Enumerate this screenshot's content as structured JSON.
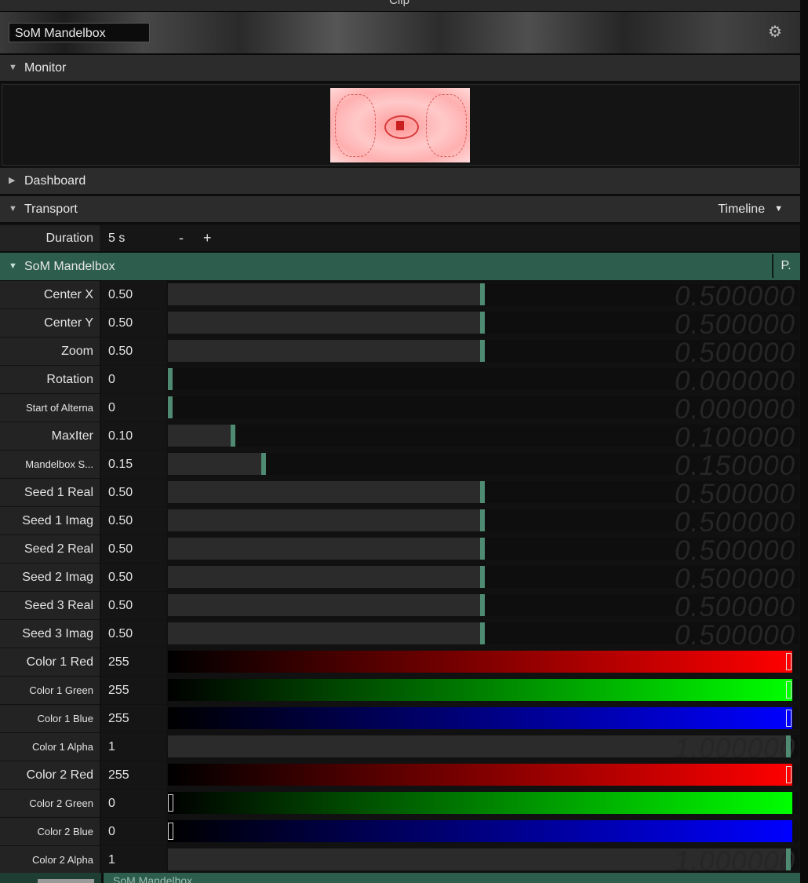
{
  "window": {
    "title": "Clip"
  },
  "clip": {
    "name": "SoM Mandelbox",
    "settings_icon": "gear-icon"
  },
  "sections": {
    "monitor": "Monitor",
    "dashboard": "Dashboard",
    "transport": "Transport",
    "transport_mode": "Timeline"
  },
  "duration": {
    "label": "Duration",
    "value": "5 s",
    "minus": "-",
    "plus": "+"
  },
  "effect": {
    "name": "SoM Mandelbox",
    "p_button": "P."
  },
  "params": [
    {
      "label": "Center X",
      "value": "0.50",
      "level": 0.5,
      "ghost": "0.500000"
    },
    {
      "label": "Center Y",
      "value": "0.50",
      "level": 0.5,
      "ghost": "0.500000"
    },
    {
      "label": "Zoom",
      "value": "0.50",
      "level": 0.5,
      "ghost": "0.500000"
    },
    {
      "label": "Rotation",
      "value": "0",
      "level": 0.0,
      "ghost": "0.000000"
    },
    {
      "label": "Start of Alterna",
      "value": "0",
      "level": 0.0,
      "ghost": "0.000000"
    },
    {
      "label": "MaxIter",
      "value": "0.10",
      "level": 0.1,
      "ghost": "0.100000"
    },
    {
      "label": "Mandelbox S...",
      "value": "0.15",
      "level": 0.15,
      "ghost": "0.150000"
    },
    {
      "label": "Seed 1 Real",
      "value": "0.50",
      "level": 0.5,
      "ghost": "0.500000"
    },
    {
      "label": "Seed 1 Imag",
      "value": "0.50",
      "level": 0.5,
      "ghost": "0.500000"
    },
    {
      "label": "Seed 2 Real",
      "value": "0.50",
      "level": 0.5,
      "ghost": "0.500000"
    },
    {
      "label": "Seed 2 Imag",
      "value": "0.50",
      "level": 0.5,
      "ghost": "0.500000"
    },
    {
      "label": "Seed 3 Real",
      "value": "0.50",
      "level": 0.5,
      "ghost": "0.500000"
    },
    {
      "label": "Seed 3 Imag",
      "value": "0.50",
      "level": 0.5,
      "ghost": "0.500000"
    },
    {
      "label": "Color 1 Red",
      "value": "255",
      "level": 1.0,
      "color": "#ff0000"
    },
    {
      "label": "Color 1 Green",
      "value": "255",
      "level": 1.0,
      "color": "#00ff00"
    },
    {
      "label": "Color 1 Blue",
      "value": "255",
      "level": 1.0,
      "color": "#0000ff"
    },
    {
      "label": "Color 1 Alpha",
      "value": "1",
      "level": 1.0,
      "ghost": "1.000000"
    },
    {
      "label": "Color 2 Red",
      "value": "255",
      "level": 1.0,
      "color": "#ff0000"
    },
    {
      "label": "Color 2 Green",
      "value": "0",
      "level": 0.0,
      "color": "#00ff00"
    },
    {
      "label": "Color 2 Blue",
      "value": "0",
      "level": 0.0,
      "color": "#0000ff"
    },
    {
      "label": "Color 2 Alpha",
      "value": "1",
      "level": 1.0,
      "ghost": "1.000000"
    }
  ],
  "footer": {
    "label": "SoM Mandelbox"
  },
  "colors": {
    "accent": "#2c5d4d",
    "handle": "#4e8b72"
  }
}
